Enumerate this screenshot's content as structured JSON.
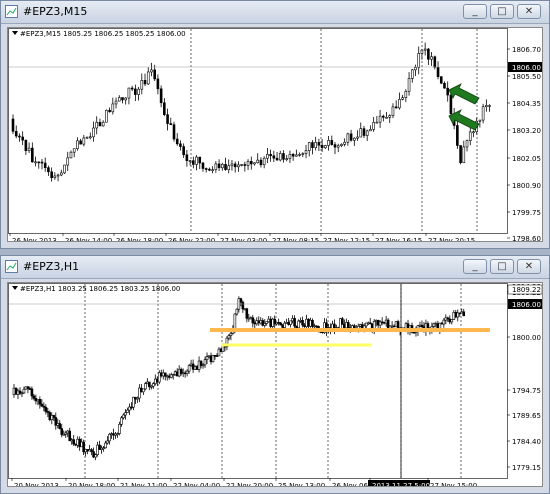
{
  "windows": [
    {
      "id": "m15",
      "title": "#EPZ3,M15",
      "info": "#EPZ3,M15   1805.25  1806.25  1805.25  1806.00",
      "price_tag": "1806.00",
      "y_labels": [
        "1806.70",
        "1805.50",
        "1804.35",
        "1803.20",
        "1802.05",
        "1800.90",
        "1799.75",
        "1798.60"
      ],
      "x_labels": [
        "26 Nov 2013",
        "26 Nov 14:00",
        "26 Nov 18:00",
        "26 Nov 22:00",
        "27 Nov 03:00",
        "27 Nov 08:15",
        "27 Nov 12:15",
        "27 Nov 16:15",
        "27 Nov 20:15"
      ],
      "buttons": [
        "_",
        "□",
        "✕"
      ]
    },
    {
      "id": "h1",
      "title": "#EPZ3,H1",
      "info": "#EPZ3,H1   1803.25  1806.25  1803.25  1806.00",
      "price_tag": "1806.00",
      "price_tag2": "1809.22",
      "y_labels": [
        "1814.90",
        "1809.22",
        "1800.00",
        "1794.75",
        "1789.65",
        "1784.40",
        "1779.15",
        "1774.05"
      ],
      "x_labels": [
        "20 Nov 2013",
        "20 Nov 18:00",
        "21 Nov 11:00",
        "22 Nov 04:00",
        "22 Nov 20:00",
        "25 Nov 13:00",
        "26 Nov 06:00",
        "2013.11.27 5:00",
        "27 Nov 15:00"
      ],
      "buttons": [
        "_",
        "□",
        "✕"
      ]
    }
  ],
  "colors": {
    "orange_line": "#ffb84d",
    "yellow_line": "#ffff66",
    "arrow": "#1f7a1f"
  }
}
